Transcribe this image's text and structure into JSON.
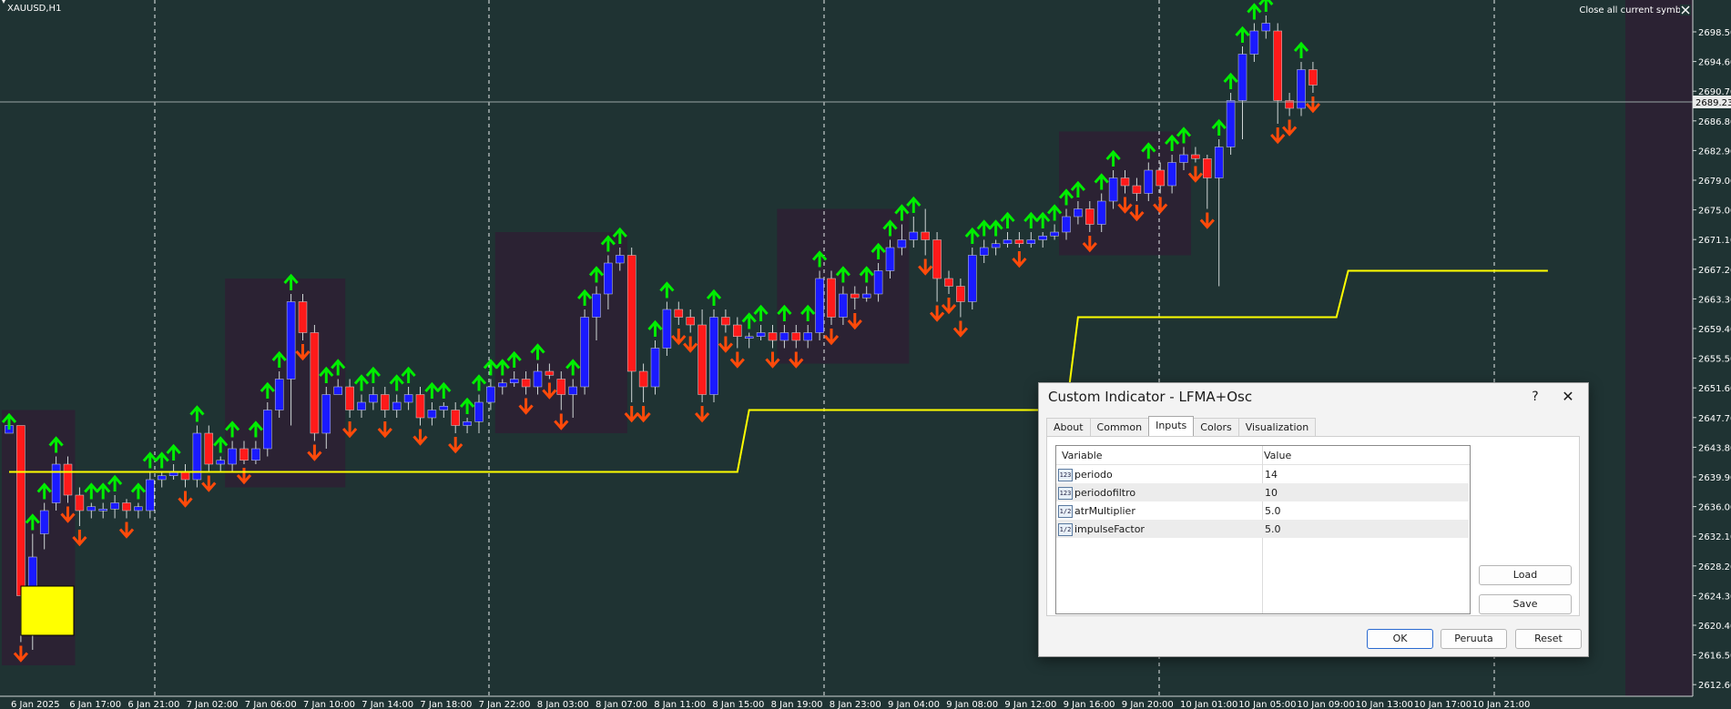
{
  "window": {
    "symbol_label": "XAUUSD,H1",
    "close_all_label": "Close all current symbol"
  },
  "colors": {
    "background": "#1f3333",
    "bull": "#1a1aff",
    "bear": "#ff1a1a",
    "arrow_up": "#00ee00",
    "arrow_down": "#ff4a0a",
    "line": "#ffff00",
    "box": "#2b2233",
    "highlight": "#ffff00"
  },
  "price_axis": {
    "labels": [
      "2698.50",
      "2694.60",
      "2690.70",
      "2686.80",
      "2682.90",
      "2679.00",
      "2675.00",
      "2671.10",
      "2667.20",
      "2663.30",
      "2659.40",
      "2655.50",
      "2651.60",
      "2647.70",
      "2643.80",
      "2639.90",
      "2636.00",
      "2632.10",
      "2628.20",
      "2624.30",
      "2620.40",
      "2616.50",
      "2612.60"
    ],
    "current_price": "2689.23"
  },
  "time_axis": {
    "labels": [
      "6 Jan 2025",
      "6 Jan 17:00",
      "6 Jan 21:00",
      "7 Jan 02:00",
      "7 Jan 06:00",
      "7 Jan 10:00",
      "7 Jan 14:00",
      "7 Jan 18:00",
      "7 Jan 22:00",
      "8 Jan 03:00",
      "8 Jan 07:00",
      "8 Jan 11:00",
      "8 Jan 15:00",
      "8 Jan 19:00",
      "8 Jan 23:00",
      "9 Jan 04:00",
      "9 Jan 08:00",
      "9 Jan 12:00",
      "9 Jan 16:00",
      "9 Jan 20:00",
      "10 Jan 01:00",
      "10 Jan 05:00",
      "10 Jan 09:00",
      "10 Jan 13:00",
      "10 Jan 17:00",
      "10 Jan 21:00"
    ]
  },
  "chart_data": {
    "type": "candlestick",
    "y_range": [
      2611,
      2701
    ],
    "candles": [
      [
        2645,
        2646,
        2645,
        2646
      ],
      [
        2646,
        2624,
        2646,
        2618
      ],
      [
        2624,
        2629,
        2632,
        2617
      ],
      [
        2632,
        2635,
        2636,
        2630
      ],
      [
        2636,
        2641,
        2642,
        2635
      ],
      [
        2641,
        2637,
        2642,
        2636
      ],
      [
        2637,
        2635,
        2638,
        2633
      ],
      [
        2635,
        2635.5,
        2636,
        2634
      ],
      [
        2635,
        2635.2,
        2636,
        2634
      ],
      [
        2635.2,
        2636,
        2637,
        2634
      ],
      [
        2636,
        2635,
        2636.5,
        2634
      ],
      [
        2635,
        2635.5,
        2636,
        2634
      ],
      [
        2635,
        2639,
        2640,
        2634
      ],
      [
        2639,
        2639.5,
        2640,
        2638
      ],
      [
        2639.5,
        2640,
        2641,
        2639
      ],
      [
        2640,
        2639,
        2641,
        2638
      ],
      [
        2639,
        2645,
        2646,
        2638
      ],
      [
        2645,
        2641,
        2646,
        2640
      ],
      [
        2641,
        2641.5,
        2642,
        2640
      ],
      [
        2641,
        2643,
        2644,
        2640
      ],
      [
        2643,
        2641.5,
        2644,
        2641
      ],
      [
        2641.5,
        2643,
        2644,
        2641
      ],
      [
        2643,
        2648,
        2649,
        2642
      ],
      [
        2648,
        2652,
        2653,
        2647
      ],
      [
        2652,
        2662,
        2663,
        2646
      ],
      [
        2662,
        2658,
        2663,
        2657
      ],
      [
        2658,
        2645,
        2659,
        2644
      ],
      [
        2645,
        2650,
        2651,
        2643
      ],
      [
        2650,
        2651,
        2652,
        2650
      ],
      [
        2651,
        2648,
        2652,
        2647
      ],
      [
        2648,
        2649,
        2650,
        2647
      ],
      [
        2649,
        2650,
        2651,
        2648
      ],
      [
        2650,
        2648,
        2651,
        2647
      ],
      [
        2648,
        2649,
        2650,
        2647
      ],
      [
        2649,
        2650,
        2651,
        2648
      ],
      [
        2650,
        2647,
        2651,
        2646
      ],
      [
        2647,
        2648,
        2649,
        2646
      ],
      [
        2648,
        2648.5,
        2649,
        2647
      ],
      [
        2648,
        2646,
        2649,
        2645
      ],
      [
        2646,
        2646.5,
        2647,
        2645
      ],
      [
        2646.5,
        2649,
        2650,
        2645
      ],
      [
        2649,
        2651,
        2652,
        2648
      ],
      [
        2651,
        2651.5,
        2652,
        2650
      ],
      [
        2651.5,
        2652,
        2653,
        2651
      ],
      [
        2652,
        2651,
        2653,
        2650
      ],
      [
        2651,
        2653,
        2654,
        2650
      ],
      [
        2653,
        2652.5,
        2654,
        2652
      ],
      [
        2652,
        2650,
        2653,
        2648
      ],
      [
        2650,
        2651,
        2652,
        2647
      ],
      [
        2651,
        2660,
        2661,
        2650
      ],
      [
        2660,
        2663,
        2664,
        2657
      ],
      [
        2663,
        2667,
        2668,
        2661
      ],
      [
        2667,
        2668,
        2669,
        2666
      ],
      [
        2668,
        2653,
        2669,
        2649
      ],
      [
        2653,
        2651,
        2654,
        2649
      ],
      [
        2651,
        2656,
        2657,
        2650
      ],
      [
        2656,
        2661,
        2662,
        2655
      ],
      [
        2661,
        2660,
        2662,
        2659
      ],
      [
        2660,
        2659,
        2661,
        2658
      ],
      [
        2659,
        2650,
        2661,
        2649
      ],
      [
        2650,
        2660,
        2661,
        2649
      ],
      [
        2660,
        2659,
        2661,
        2658
      ],
      [
        2659,
        2657.5,
        2660,
        2656
      ],
      [
        2657.5,
        2657.5,
        2658,
        2656
      ],
      [
        2657.5,
        2658,
        2659,
        2657
      ],
      [
        2658,
        2657,
        2659,
        2656
      ],
      [
        2657,
        2658,
        2659,
        2656
      ],
      [
        2658,
        2657,
        2659,
        2656
      ],
      [
        2657,
        2658,
        2659,
        2656
      ],
      [
        2658,
        2665,
        2666,
        2657
      ],
      [
        2665,
        2660,
        2666,
        2659
      ],
      [
        2660,
        2663,
        2664,
        2659
      ],
      [
        2663,
        2662.5,
        2664,
        2661
      ],
      [
        2662.5,
        2663,
        2664,
        2662
      ],
      [
        2663,
        2666,
        2667,
        2662
      ],
      [
        2666,
        2669,
        2670,
        2665
      ],
      [
        2669,
        2670,
        2672,
        2668
      ],
      [
        2670,
        2671,
        2673,
        2669
      ],
      [
        2671,
        2670,
        2674,
        2668
      ],
      [
        2670,
        2665,
        2671,
        2662
      ],
      [
        2665,
        2664,
        2666,
        2663
      ],
      [
        2664,
        2662,
        2665,
        2660
      ],
      [
        2662,
        2668,
        2669,
        2661
      ],
      [
        2668,
        2669,
        2670,
        2667
      ],
      [
        2669,
        2669.5,
        2670,
        2668
      ],
      [
        2669.5,
        2670,
        2671,
        2669
      ],
      [
        2670,
        2669.5,
        2671,
        2669
      ],
      [
        2669.5,
        2670,
        2671,
        2669
      ],
      [
        2670,
        2670.5,
        2671,
        2669
      ],
      [
        2670.5,
        2671,
        2672,
        2670
      ],
      [
        2671,
        2673,
        2674,
        2670
      ],
      [
        2673,
        2674,
        2675,
        2672
      ],
      [
        2674,
        2672,
        2675,
        2671
      ],
      [
        2672,
        2675,
        2676,
        2671
      ],
      [
        2675,
        2678,
        2679,
        2674
      ],
      [
        2678,
        2677,
        2679,
        2676
      ],
      [
        2677,
        2676,
        2678,
        2675
      ],
      [
        2676,
        2679,
        2680,
        2675
      ],
      [
        2679,
        2677,
        2680,
        2676
      ],
      [
        2677,
        2680,
        2681,
        2676
      ],
      [
        2680,
        2681,
        2682,
        2679
      ],
      [
        2681,
        2680.5,
        2682,
        2680
      ],
      [
        2680.5,
        2678,
        2681,
        2674
      ],
      [
        2678,
        2682,
        2683,
        2664
      ],
      [
        2682,
        2688,
        2689,
        2681
      ],
      [
        2688,
        2694,
        2695,
        2683
      ],
      [
        2694,
        2697,
        2698,
        2693
      ],
      [
        2697,
        2698,
        2699,
        2696
      ],
      [
        2697,
        2688,
        2698,
        2685
      ],
      [
        2688,
        2687,
        2689,
        2686
      ],
      [
        2687,
        2692,
        2693,
        2686
      ],
      [
        2692,
        2690,
        2693,
        2689
      ]
    ],
    "yellow_line": [
      [
        0,
        2640
      ],
      [
        62,
        2640
      ],
      [
        63,
        2648
      ],
      [
        90,
        2648
      ],
      [
        91,
        2660
      ],
      [
        113,
        2660
      ],
      [
        114,
        2666
      ],
      [
        131,
        2666
      ]
    ]
  },
  "dialog": {
    "title": "Custom Indicator - LFMA+Osc",
    "help": "?",
    "close": "✕",
    "tabs": [
      "About",
      "Common",
      "Inputs",
      "Colors",
      "Visualization"
    ],
    "active_tab": "Inputs",
    "headers": {
      "variable": "Variable",
      "value": "Value"
    },
    "params": [
      {
        "icon": "123",
        "name": "periodo",
        "value": "14"
      },
      {
        "icon": "123",
        "name": "periodofiltro",
        "value": "10"
      },
      {
        "icon": "1/2",
        "name": "atrMultiplier",
        "value": "5.0"
      },
      {
        "icon": "1/2",
        "name": "impulseFactor",
        "value": "5.0"
      }
    ],
    "buttons": {
      "load": "Load",
      "save": "Save",
      "ok": "OK",
      "cancel": "Peruuta",
      "reset": "Reset"
    }
  }
}
